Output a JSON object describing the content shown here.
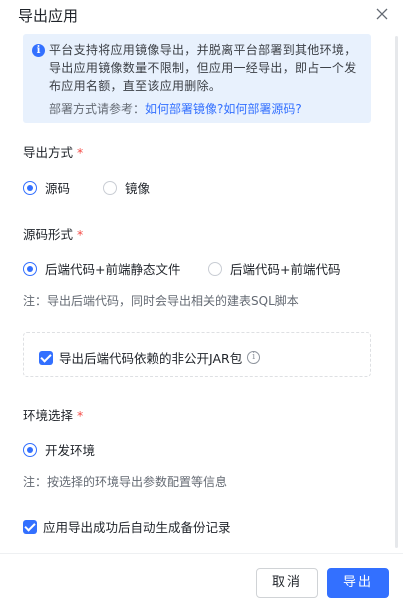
{
  "dialog": {
    "title": "导出应用"
  },
  "info": {
    "text": "平台支持将应用镜像导出，并脱离平台部署到其他环境，导出应用镜像数量不限制，但应用一经导出，即占一个发布应用名额，直至该应用删除。",
    "ref_label": "部署方式请参考：",
    "link_image": "如何部署镜像?",
    "link_source": "如何部署源码?"
  },
  "export_method": {
    "label": "导出方式",
    "required": "*",
    "options": [
      {
        "label": "源码",
        "checked": true
      },
      {
        "label": "镜像",
        "checked": false
      }
    ]
  },
  "source_form": {
    "label": "源码形式",
    "required": "*",
    "options": [
      {
        "label": "后端代码+前端静态文件",
        "checked": true
      },
      {
        "label": "后端代码+前端代码",
        "checked": false
      }
    ],
    "note": "注：导出后端代码，同时会导出相关的建表SQL脚本"
  },
  "jar_option": {
    "label": "导出后端代码依赖的非公开JAR包",
    "checked": true,
    "help_icon": "info-circle-icon"
  },
  "environment": {
    "label": "环境选择",
    "required": "*",
    "options": [
      {
        "label": "开发环境",
        "checked": true
      }
    ],
    "note": "注：按选择的环境导出参数配置等信息"
  },
  "backup_option": {
    "label": "应用导出成功后自动生成备份记录",
    "checked": true
  },
  "footer": {
    "cancel_label": "取消",
    "confirm_label": "导出"
  },
  "colors": {
    "primary": "#3370ff",
    "info_bg": "#e8f1fd",
    "required": "#f54a45"
  }
}
